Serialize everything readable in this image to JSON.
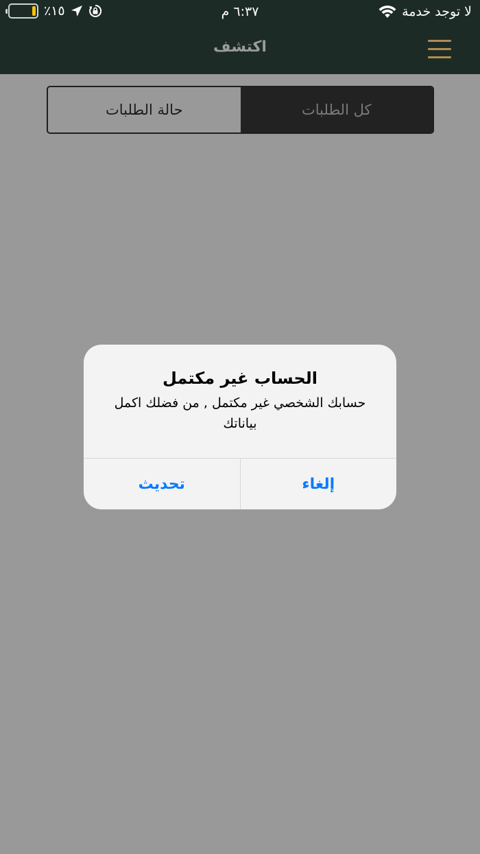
{
  "status_bar": {
    "carrier": "لا توجد خدمة",
    "time": "٦:٣٧ م",
    "battery_percent": "٪١٥",
    "battery_level": 0.15,
    "battery_color": "#f2c20e",
    "icons": [
      "wifi-icon",
      "location-arrow-icon",
      "rotation-lock-icon",
      "battery-icon"
    ]
  },
  "nav_bar": {
    "title": "اكتشف",
    "menu_icon": "hamburger-menu-icon",
    "background": "#1d2b27",
    "accent": "#b08d4e"
  },
  "segmented_control": {
    "segments": [
      {
        "label": "حالة الطلبات",
        "selected": false
      },
      {
        "label": "كل الطلبات",
        "selected": true
      }
    ]
  },
  "alert": {
    "title": "الحساب غير مكتمل",
    "message": "حسابك الشخصي غير مكتمل , من فضلك اكمل بياناتك",
    "buttons": {
      "refresh": "تحديث",
      "cancel": "إلغاء"
    },
    "button_color": "#0a7aff"
  }
}
